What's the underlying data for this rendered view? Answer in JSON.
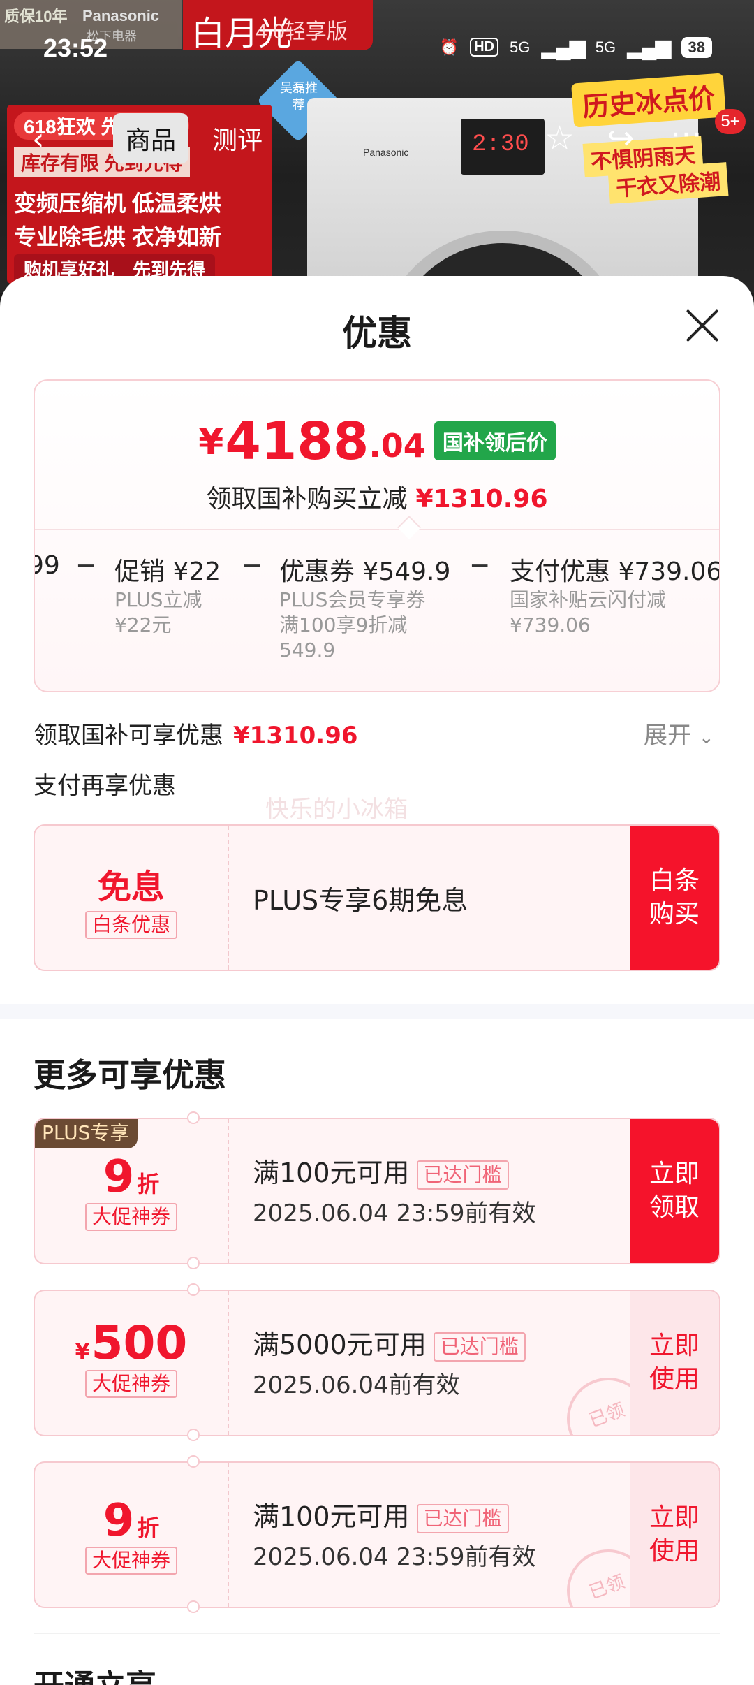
{
  "status_bar": {
    "time": "23:52",
    "hd": "HD",
    "net1": "5G",
    "net2": "5G",
    "battery": "38"
  },
  "background": {
    "brand": "Panasonic",
    "brand_sub": "松下电器",
    "warranty": "质保10年",
    "product_name_big": "白月光",
    "product_name": "4.0轻享版",
    "recommend": "吴磊推荐",
    "promo_lines": [
      "618狂欢 先到先得",
      "库存有限 先到先得",
      "变频压缩机 低温柔烘",
      "专业除毛烘 衣净如新",
      "购机享好礼　先到先得"
    ],
    "history_price": "历史冰点价",
    "rain_line1": "不惧阴雨天",
    "rain_line2": "干衣又除潮",
    "more_count": "5+",
    "machine_logo": "Panasonic",
    "panel_time": "2:30"
  },
  "nav": {
    "tabs": [
      "商品",
      "测评"
    ],
    "back_icon": "chevron-left-icon",
    "star_icon": "star-icon",
    "share_icon": "share-icon",
    "more_icon": "more-icon"
  },
  "sheet": {
    "title": "优惠",
    "close_icon": "close-icon",
    "price": {
      "symbol": "¥",
      "integer": "4188",
      "decimal": ".04",
      "tag": "国补领后价",
      "sub_label": "领取国补购买立减",
      "sub_value": "¥1310.96"
    },
    "calc": [
      {
        "title": "99",
        "detail": []
      },
      {
        "title": "促销 ¥22",
        "detail": [
          "PLUS立减",
          "¥22元"
        ]
      },
      {
        "title": "优惠券 ¥549.9",
        "detail": [
          "PLUS会员专享券",
          "满100享9折减",
          "549.9"
        ]
      },
      {
        "title": "支付优惠 ¥739.06",
        "detail": [
          "国家补贴云闪付减",
          "¥739.06"
        ]
      }
    ],
    "calc_operator": "−",
    "subsidy_label": "领取国补可享优惠",
    "subsidy_value": "¥1310.96",
    "expand_label": "展开",
    "pay_label": "支付再享优惠",
    "watermark": "快乐的小冰箱",
    "installment": {
      "big": "免息",
      "tag": "白条优惠",
      "text": "PLUS专享6期免息",
      "button": [
        "白条",
        "购买"
      ]
    },
    "more_title": "更多可享优惠",
    "coupons": [
      {
        "badge": "PLUS专享",
        "value": "9",
        "unit": "折",
        "tag": "大促神券",
        "title": "满100元可用",
        "status": "已达门槛",
        "date": "2025.06.04 23:59前有效",
        "button": [
          "立即",
          "领取"
        ],
        "claimed": ""
      },
      {
        "badge": "",
        "value": "500",
        "unit": "¥",
        "tag": "大促神券",
        "title": "满5000元可用",
        "status": "已达门槛",
        "date": "2025.06.04前有效",
        "button": [
          "立即",
          "使用"
        ],
        "claimed": "已领"
      },
      {
        "badge": "",
        "value": "9",
        "unit": "折",
        "tag": "大促神券",
        "title": "满100元可用",
        "status": "已达门槛",
        "date": "2025.06.04 23:59前有效",
        "button": [
          "立即",
          "使用"
        ],
        "claimed": "已领"
      }
    ],
    "bottom_title": "开通立享"
  },
  "colors": {
    "accent_red": "#f0162d",
    "green_tag": "#22a64a",
    "plus_brown": "#6b4a33"
  }
}
